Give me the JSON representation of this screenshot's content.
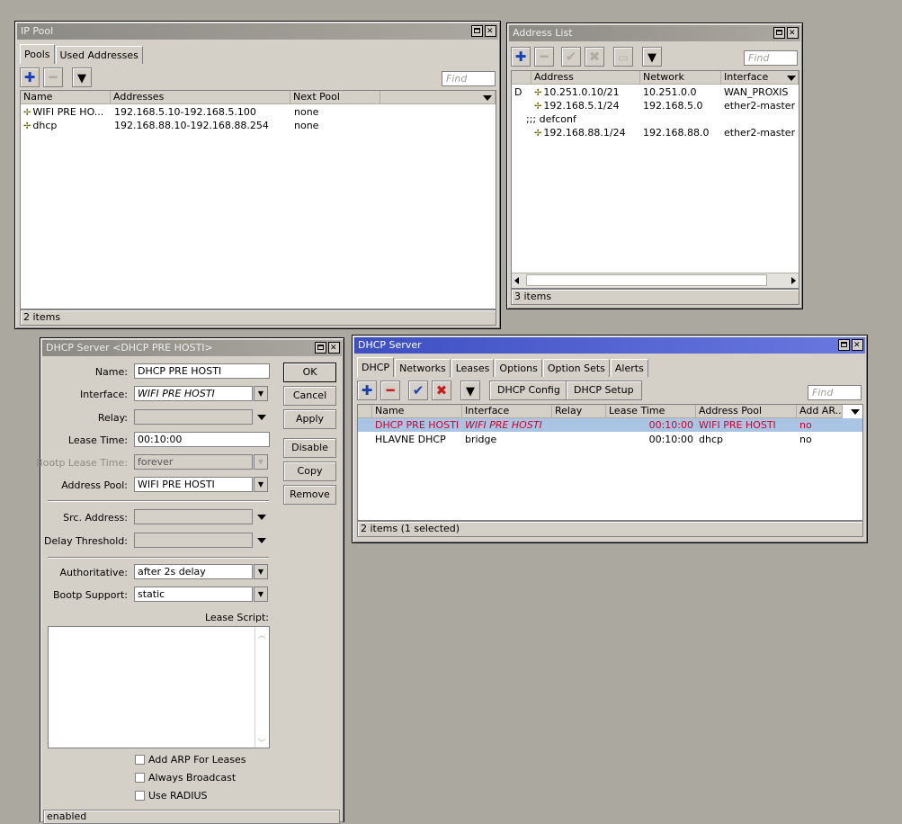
{
  "ip_pool": {
    "title": "IP Pool",
    "tabs": [
      "Pools",
      "Used Addresses"
    ],
    "find_placeholder": "Find",
    "columns": [
      "Name",
      "Addresses",
      "Next Pool"
    ],
    "rows": [
      {
        "name": "WIFI PRE HO...",
        "addresses": "192.168.5.10-192.168.5.100",
        "next_pool": "none"
      },
      {
        "name": "dhcp",
        "addresses": "192.168.88.10-192.168.88.254",
        "next_pool": "none"
      }
    ],
    "status": "2 items"
  },
  "address_list": {
    "title": "Address List",
    "find_placeholder": "Find",
    "columns": [
      "Address",
      "Network",
      "Interface"
    ],
    "rows": [
      {
        "flag": "D",
        "address": "10.251.0.10/21",
        "network": "10.251.0.0",
        "interface": "WAN_PROXIS"
      },
      {
        "flag": "",
        "address": "192.168.5.1/24",
        "network": "192.168.5.0",
        "interface": "ether2-master"
      },
      {
        "comment": ";;; defconf"
      },
      {
        "flag": "",
        "address": "192.168.88.1/24",
        "network": "192.168.88.0",
        "interface": "ether2-master"
      }
    ],
    "status": "3 items"
  },
  "dhcp_server_edit": {
    "title": "DHCP Server <DHCP PRE HOSTI>",
    "fields": {
      "name_label": "Name:",
      "name_value": "DHCP PRE HOSTI",
      "interface_label": "Interface:",
      "interface_value": "WIFI PRE HOSTI",
      "relay_label": "Relay:",
      "lease_time_label": "Lease Time:",
      "lease_time_value": "00:10:00",
      "bootp_lease_label": "Bootp Lease Time:",
      "bootp_lease_value": "forever",
      "address_pool_label": "Address Pool:",
      "address_pool_value": "WIFI PRE HOSTI",
      "src_address_label": "Src. Address:",
      "delay_threshold_label": "Delay Threshold:",
      "authoritative_label": "Authoritative:",
      "authoritative_value": "after 2s delay",
      "bootp_support_label": "Bootp Support:",
      "bootp_support_value": "static",
      "lease_script_label": "Lease Script:"
    },
    "buttons": [
      "OK",
      "Cancel",
      "Apply",
      "Disable",
      "Copy",
      "Remove"
    ],
    "checkboxes": [
      "Add ARP For Leases",
      "Always Broadcast",
      "Use RADIUS"
    ],
    "status": "enabled"
  },
  "dhcp_server": {
    "title": "DHCP Server",
    "tabs": [
      "DHCP",
      "Networks",
      "Leases",
      "Options",
      "Option Sets",
      "Alerts"
    ],
    "buttons": [
      "DHCP Config",
      "DHCP Setup"
    ],
    "find_placeholder": "Find",
    "columns": [
      "Name",
      "Interface",
      "Relay",
      "Lease Time",
      "Address Pool",
      "Add AR..."
    ],
    "rows": [
      {
        "name": "DHCP PRE HOSTI",
        "interface": "WIFI PRE HOSTI",
        "relay": "",
        "lease_time": "00:10:00",
        "address_pool": "WIFI PRE HOSTI",
        "add_arp": "no"
      },
      {
        "name": "HLAVNE DHCP",
        "interface": "bridge",
        "relay": "",
        "lease_time": "00:10:00",
        "address_pool": "dhcp",
        "add_arp": "no"
      }
    ],
    "status": "2 items (1 selected)"
  },
  "colors": {
    "desktop": "#aba89f",
    "window": "#d4d0c8",
    "active_title": "#3d4fc2",
    "selected_row": "#aac5e3",
    "disabled_text": "#d2002a"
  }
}
